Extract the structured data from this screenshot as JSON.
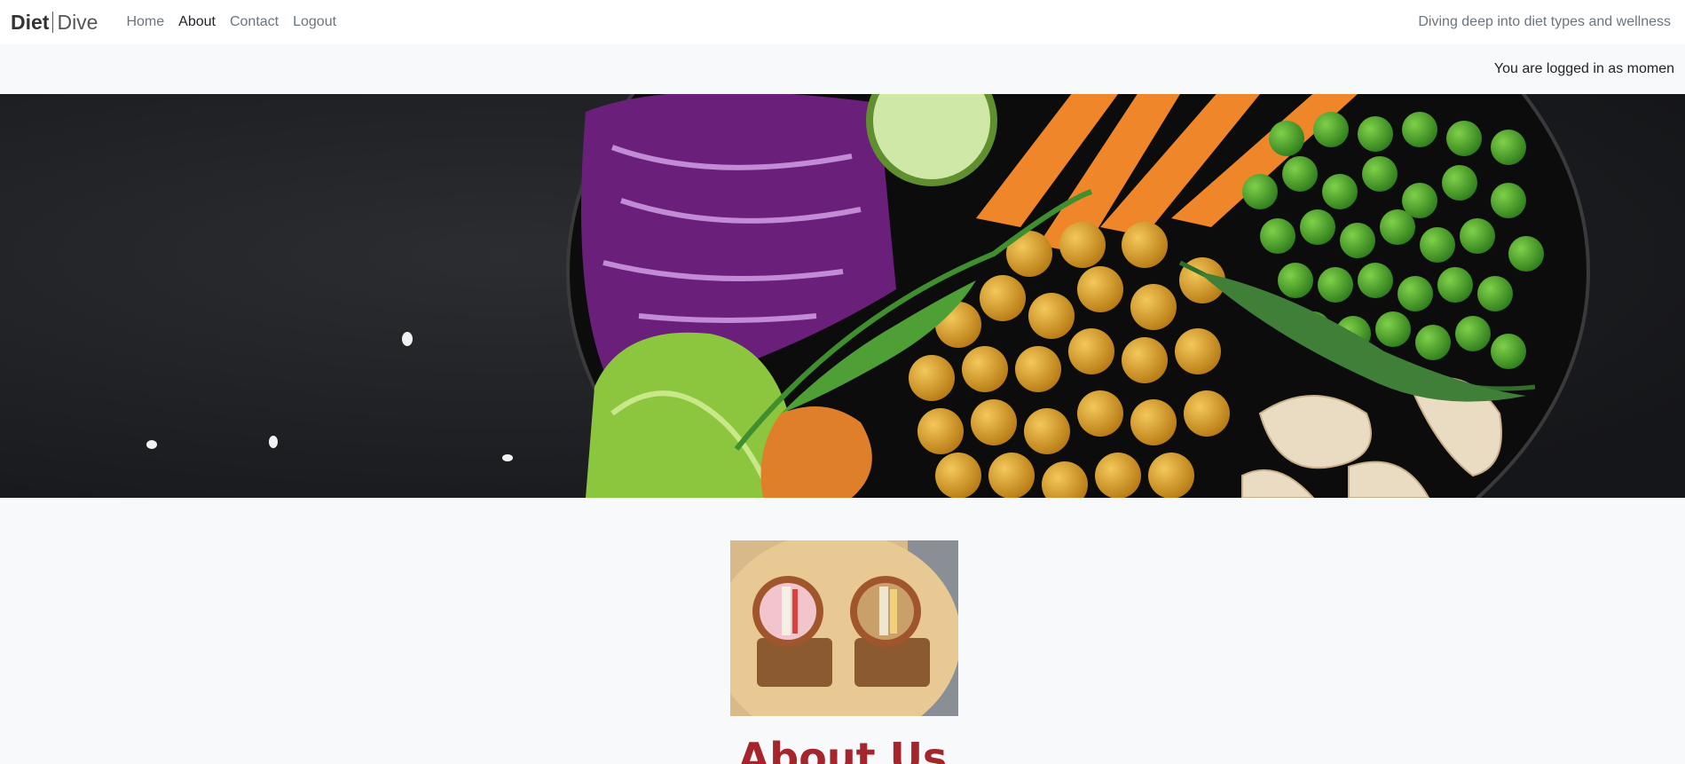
{
  "brand": {
    "part1": "Diet",
    "part2": "Dive"
  },
  "nav": {
    "items": [
      {
        "label": "Home",
        "active": false
      },
      {
        "label": "About",
        "active": true
      },
      {
        "label": "Contact",
        "active": false
      },
      {
        "label": "Logout",
        "active": false
      }
    ]
  },
  "tagline": "Diving deep into diet types and wellness",
  "login_status": "You are logged in as momen",
  "about": {
    "title": "About Us"
  },
  "colors": {
    "heading": "#a4262c",
    "navbar_bg": "#ffffff",
    "page_bg": "#f8f9fa",
    "muted_text": "#6c757d"
  }
}
